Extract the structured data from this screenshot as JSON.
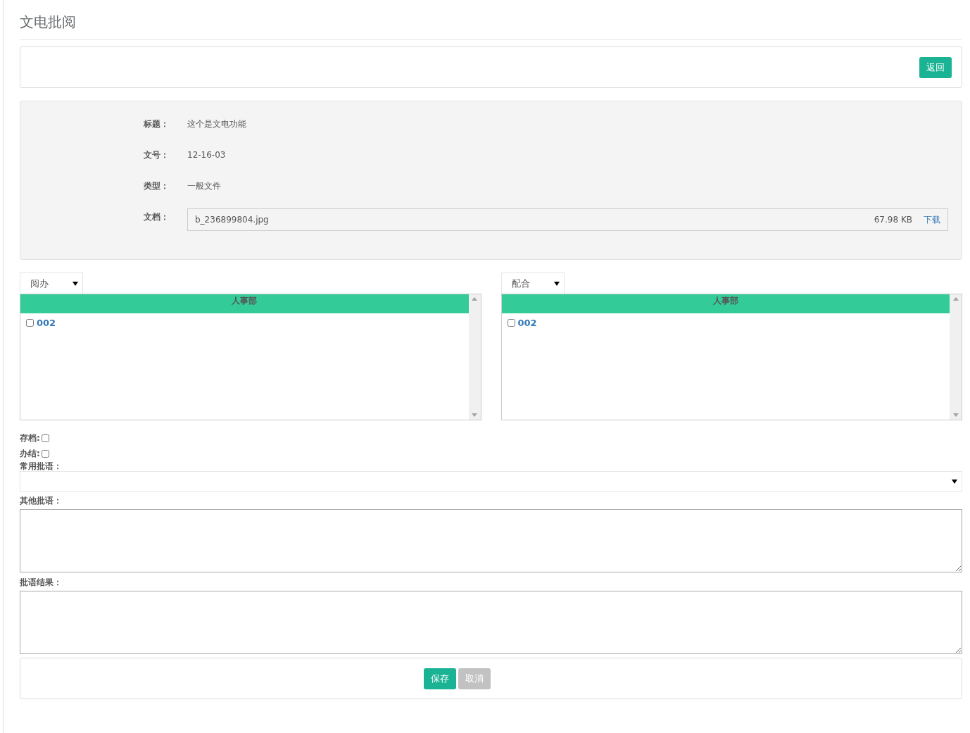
{
  "page_title": "文电批阅",
  "back_button": "返回",
  "fields": [
    {
      "label": "标题：",
      "value": "这个是文电功能"
    },
    {
      "label": "文号：",
      "value": "12-16-03"
    },
    {
      "label": "类型：",
      "value": "一般文件"
    }
  ],
  "attachment": {
    "label": "文档：",
    "file_name": "b_236899804.jpg",
    "size": "67.98 KB",
    "download": "下载"
  },
  "recipient_panels": [
    {
      "select": "阅办",
      "group": "人事部",
      "members": [
        {
          "name": "002",
          "checked": false
        }
      ]
    },
    {
      "select": "配合",
      "group": "人事部",
      "members": [
        {
          "name": "002",
          "checked": false
        }
      ]
    }
  ],
  "options": [
    {
      "label": "存档:",
      "checked": false
    },
    {
      "label": "办结:",
      "checked": false
    }
  ],
  "common_comment_label": "常用批语：",
  "other_comment_label": "其他批语：",
  "result_label": "批语结果：",
  "buttons": [
    {
      "label": "保存",
      "kind": "primary"
    },
    {
      "label": "取消",
      "kind": "secondary"
    }
  ]
}
